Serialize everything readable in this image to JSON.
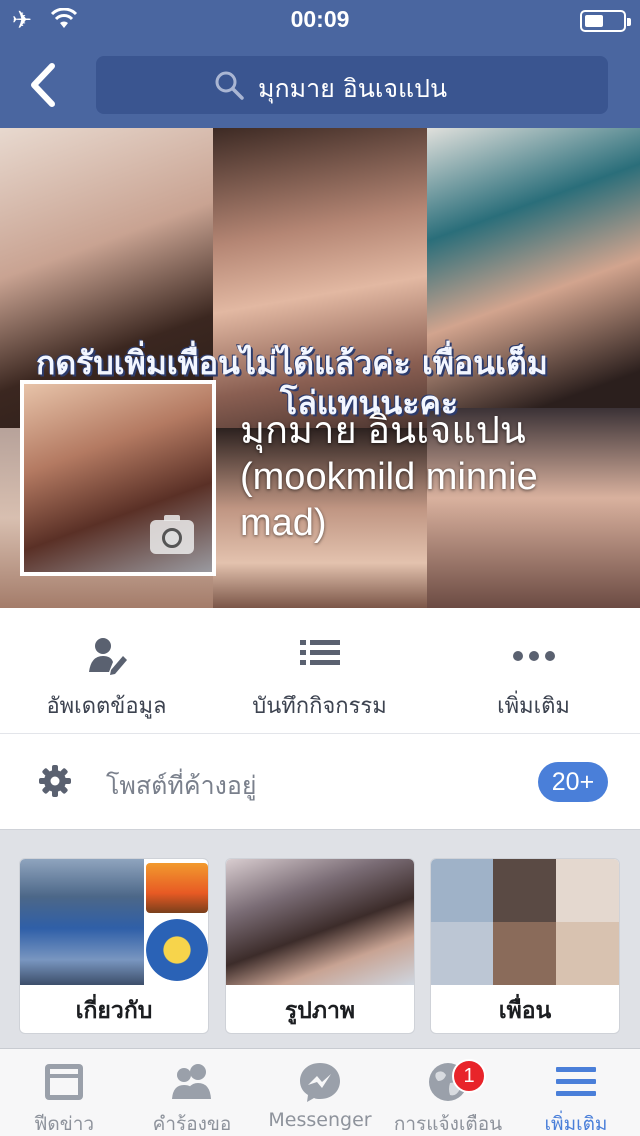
{
  "status_bar": {
    "time": "00:09"
  },
  "nav": {
    "search_text": "มุกมาย อินเจแปน"
  },
  "cover": {
    "overlay_line1": "กดรับเพิ่มเพื่อนไม่ได้แล้วค่ะ เพื่อนเต็ม",
    "overlay_line2": "โล่แทนนะคะ"
  },
  "profile": {
    "name_line1": "มุกมาย อินเจแปน",
    "name_line2": "(mookmild minnie",
    "name_line3": "mad)"
  },
  "actions": [
    {
      "label": "อัพเดตข้อมูล",
      "icon": "update-info-icon"
    },
    {
      "label": "บันทึกกิจกรรม",
      "icon": "activity-log-icon"
    },
    {
      "label": "เพิ่มเติม",
      "icon": "more-icon"
    }
  ],
  "pending_posts": {
    "label": "โพสต์ที่ค้างอยู่",
    "count": "20+"
  },
  "cards": [
    {
      "label": "เกี่ยวกับ"
    },
    {
      "label": "รูปภาพ"
    },
    {
      "label": "เพื่อน"
    }
  ],
  "tabbar": {
    "tabs": [
      {
        "label": "ฟีดข่าว",
        "icon": "news-feed-icon"
      },
      {
        "label": "คำร้องขอ",
        "icon": "friend-requests-icon"
      },
      {
        "label": "Messenger",
        "icon": "messenger-icon"
      },
      {
        "label": "การแจ้งเตือน",
        "icon": "globe-icon"
      },
      {
        "label": "เพิ่มเติม",
        "icon": "menu-icon"
      }
    ],
    "notification_count": "1",
    "active_index": 4
  },
  "colors": {
    "nav_blue": "#4a66a0",
    "accent_blue": "#4a7fd9",
    "badge_red": "#e8242a"
  }
}
